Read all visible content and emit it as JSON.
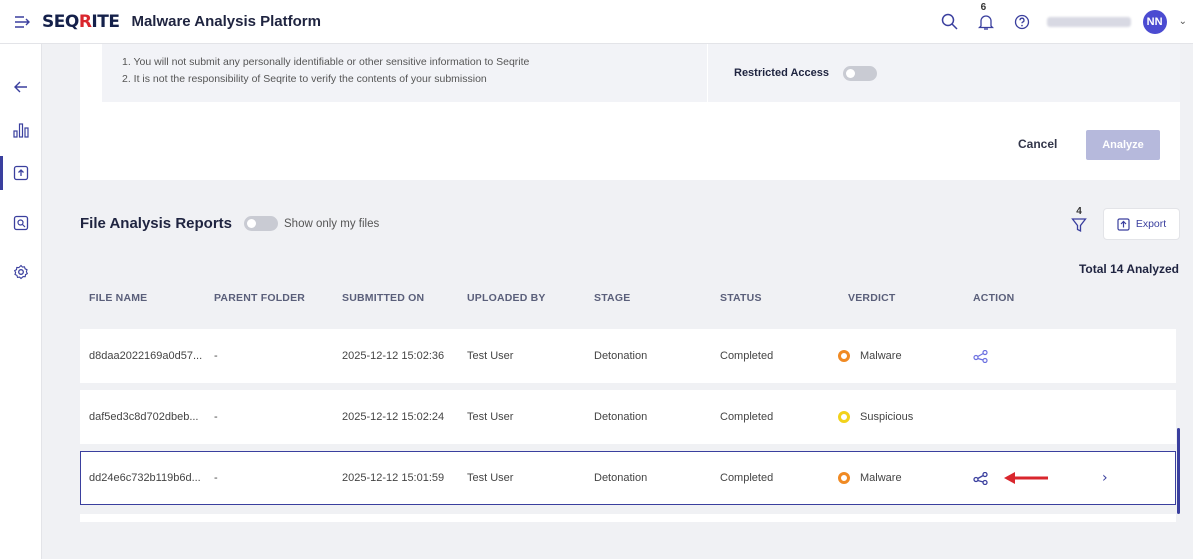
{
  "app": {
    "logo_part1": "SEQ",
    "logo_q": "R",
    "logo_part2": "ITE",
    "title": "Malware Analysis Platform"
  },
  "topbar": {
    "notification_count": "6",
    "avatar_initials": "NN"
  },
  "submission": {
    "terms": [
      "1. You will not submit any personally identifiable or other sensitive information to Seqrite",
      "2. It is not the responsibility of Seqrite to verify the contents of your submission"
    ],
    "restricted_access_label": "Restricted Access",
    "restricted_access_on": false,
    "cancel_label": "Cancel",
    "analyze_label": "Analyze"
  },
  "reports": {
    "title": "File Analysis Reports",
    "show_my_files_label": "Show only my files",
    "show_my_files_on": false,
    "filter_count": "4",
    "export_label": "Export",
    "total_label": "Total 14 Analyzed",
    "columns": [
      "FILE NAME",
      "PARENT FOLDER",
      "SUBMITTED ON",
      "UPLOADED BY",
      "STAGE",
      "STATUS",
      "VERDICT",
      "ACTION"
    ],
    "rows": [
      {
        "file_name": "d8daa2022169a0d57...",
        "parent_folder": "-",
        "submitted_on": "2025-12-12 15:02:36",
        "uploaded_by": "Test User",
        "stage": "Detonation",
        "status": "Completed",
        "verdict": "Malware",
        "verdict_color": "#f08a24",
        "has_share": true,
        "selected": false
      },
      {
        "file_name": "daf5ed3c8d702dbeb...",
        "parent_folder": "-",
        "submitted_on": "2025-12-12 15:02:24",
        "uploaded_by": "Test User",
        "stage": "Detonation",
        "status": "Completed",
        "verdict": "Suspicious",
        "verdict_color": "#f2d21b",
        "has_share": false,
        "selected": false
      },
      {
        "file_name": "dd24e6c732b119b6d...",
        "parent_folder": "-",
        "submitted_on": "2025-12-12 15:01:59",
        "uploaded_by": "Test User",
        "stage": "Detonation",
        "status": "Completed",
        "verdict": "Malware",
        "verdict_color": "#f08a24",
        "has_share": true,
        "selected": true
      }
    ]
  },
  "colors": {
    "accent": "#3a3f9e",
    "annotation_arrow": "#d9262d"
  }
}
